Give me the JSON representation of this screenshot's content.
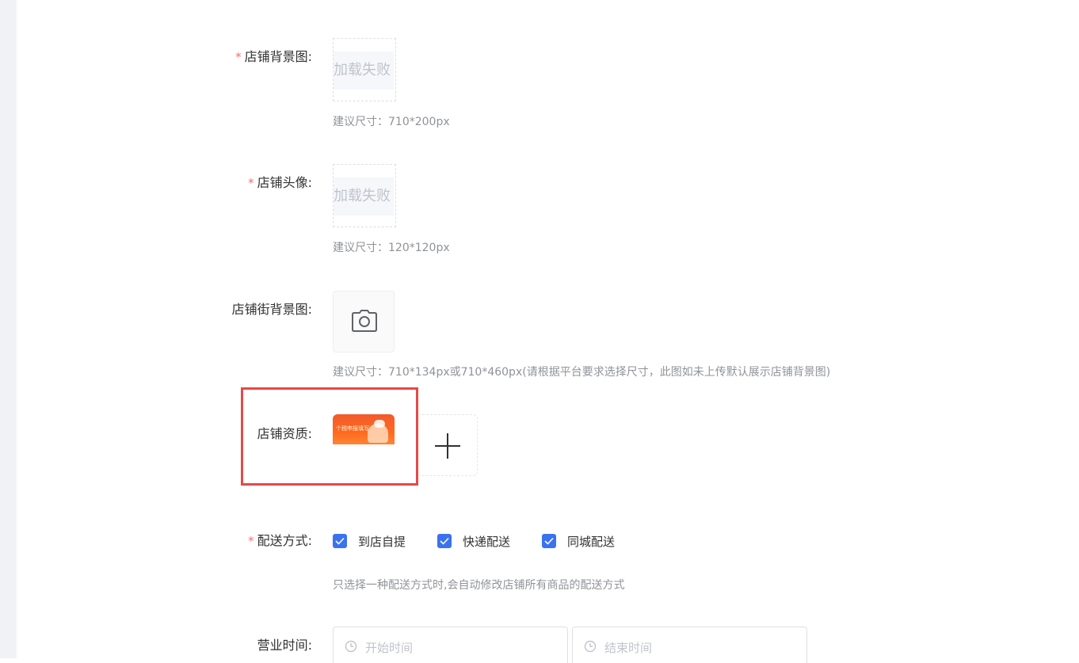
{
  "form": {
    "shop_background": {
      "required_mark": "*",
      "label": "店铺背景图:",
      "image_fail_text": "加载失败",
      "hint": "建议尺寸：710*200px"
    },
    "shop_avatar": {
      "required_mark": "*",
      "label": "店铺头像:",
      "image_fail_text": "加载失败",
      "hint": "建议尺寸：120*120px"
    },
    "street_background": {
      "label": "店铺街背景图:",
      "upload_icon": "camera-icon",
      "hint": "建议尺寸：710*134px或710*460px(请根据平台要求选择尺寸，此图如未上传默认展示店铺背景图)"
    },
    "qualification": {
      "label": "店铺资质:",
      "thumbnail_text": "个税申报填写",
      "add_icon": "plus-icon",
      "highlight_color": "#e84848"
    },
    "delivery": {
      "required_mark": "*",
      "label": "配送方式:",
      "options": [
        {
          "label": "到店自提",
          "checked": true
        },
        {
          "label": "快递配送",
          "checked": true
        },
        {
          "label": "同城配送",
          "checked": true
        }
      ],
      "hint": "只选择一种配送方式时,会自动修改店铺所有商品的配送方式"
    },
    "business_hours": {
      "label": "营业时间:",
      "start_placeholder": "开始时间",
      "end_placeholder": "结束时间"
    }
  },
  "colors": {
    "required": "#f56c6c",
    "checkbox": "#3a72ef",
    "hint_text": "#909399",
    "placeholder": "#c0c4cc"
  }
}
